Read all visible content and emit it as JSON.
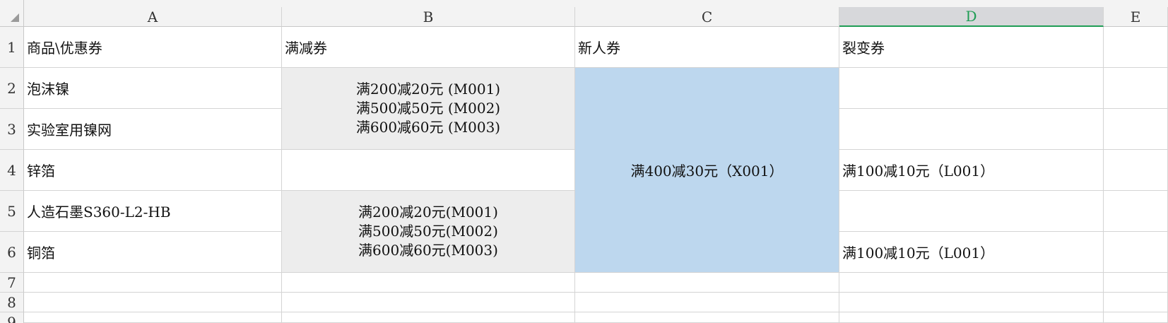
{
  "columns": [
    "A",
    "B",
    "C",
    "D",
    "E"
  ],
  "active_column": "D",
  "rows": [
    "1",
    "2",
    "3",
    "4",
    "5",
    "6",
    "7",
    "8",
    "9"
  ],
  "cells": {
    "A1": "商品\\优惠券",
    "B1": "满减券",
    "C1": "新人券",
    "D1": "裂变券",
    "A2": "泡沫镍",
    "A3": "实验室用镍网",
    "A4": "锌箔",
    "A5": "人造石墨S360-L2-HB",
    "A6": "铜箔",
    "B2_3": [
      "满200减20元 (M001)",
      "满500减50元 (M002)",
      "满600减60元 (M003)"
    ],
    "B5_6": [
      "满200减20元(M001)",
      "满500减50元(M002)",
      "满600减60元(M003)"
    ],
    "C2_6": "满400减30元（X001）",
    "D4": "满100减10元（L001）",
    "D6": "满100减10元（L001）"
  },
  "colors": {
    "merged_gray_fill": "#ededed",
    "merged_blue_fill": "#bdd7ee",
    "active_column_accent": "#1f9d55"
  }
}
